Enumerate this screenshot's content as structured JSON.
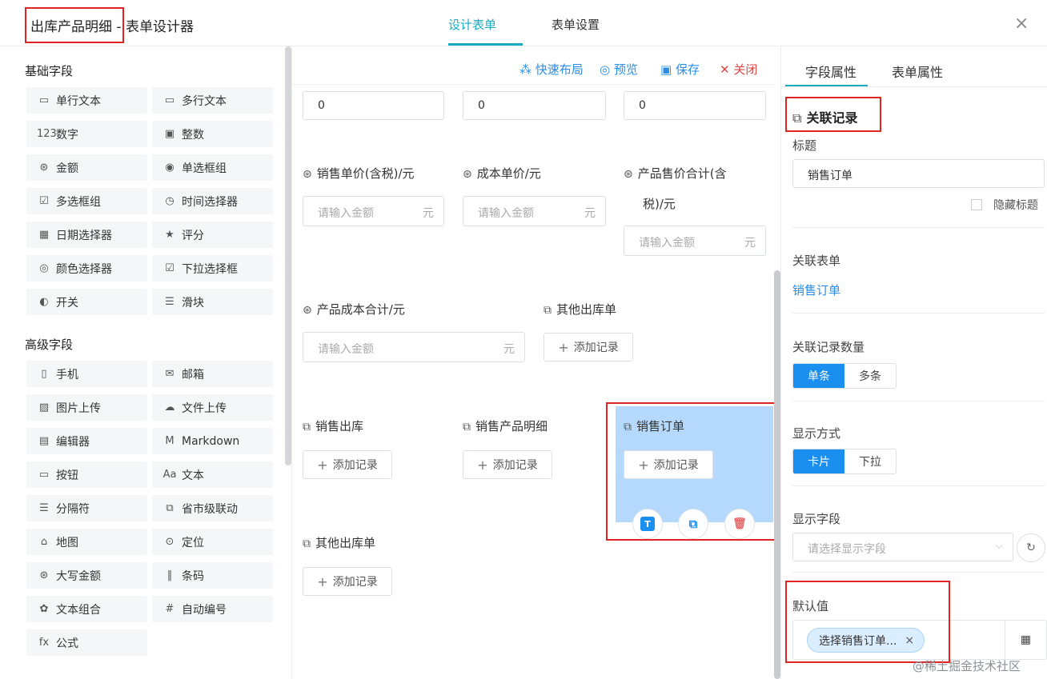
{
  "header": {
    "title_highlight": "出库产品明细",
    "title_suffix": " - 表单设计器",
    "tabs": [
      "设计表单",
      "表单设置"
    ],
    "close_icon": "×"
  },
  "palette": {
    "basic_title": "基础字段",
    "basic_items": [
      {
        "icon": "▭",
        "label": "单行文本"
      },
      {
        "icon": "▭",
        "label": "多行文本"
      },
      {
        "icon": "123",
        "label": "数字"
      },
      {
        "icon": "▣",
        "label": "整数"
      },
      {
        "icon": "⊛",
        "label": "金额"
      },
      {
        "icon": "◉",
        "label": "单选框组"
      },
      {
        "icon": "☑",
        "label": "多选框组"
      },
      {
        "icon": "◷",
        "label": "时间选择器"
      },
      {
        "icon": "▦",
        "label": "日期选择器"
      },
      {
        "icon": "★",
        "label": "评分"
      },
      {
        "icon": "◎",
        "label": "颜色选择器"
      },
      {
        "icon": "☑",
        "label": "下拉选择框"
      },
      {
        "icon": "◐",
        "label": "开关"
      },
      {
        "icon": "☰",
        "label": "滑块"
      }
    ],
    "advanced_title": "高级字段",
    "advanced_items": [
      {
        "icon": "▯",
        "label": "手机"
      },
      {
        "icon": "✉",
        "label": "邮箱"
      },
      {
        "icon": "▨",
        "label": "图片上传"
      },
      {
        "icon": "☁",
        "label": "文件上传"
      },
      {
        "icon": "▤",
        "label": "编辑器"
      },
      {
        "icon": "M",
        "label": "Markdown"
      },
      {
        "icon": "▭",
        "label": "按钮"
      },
      {
        "icon": "Aa",
        "label": "文本"
      },
      {
        "icon": "☰",
        "label": "分隔符"
      },
      {
        "icon": "⧉",
        "label": "省市级联动"
      },
      {
        "icon": "⌂",
        "label": "地图"
      },
      {
        "icon": "⊙",
        "label": "定位"
      },
      {
        "icon": "⊛",
        "label": "大写金额"
      },
      {
        "icon": "‖",
        "label": "条码"
      },
      {
        "icon": "✿",
        "label": "文本组合"
      },
      {
        "icon": "#",
        "label": "自动编号"
      },
      {
        "icon": "fx",
        "label": "公式"
      }
    ]
  },
  "toolbar": {
    "quick_layout": "快速布局",
    "preview": "预览",
    "save": "保存",
    "close": "关闭"
  },
  "canvas": {
    "number_inputs": [
      "0",
      "0",
      "0"
    ],
    "money_fields": [
      {
        "label": "销售单价(含税)/元",
        "placeholder": "请输入金额",
        "unit": "元"
      },
      {
        "label": "成本单价/元",
        "placeholder": "请输入金额",
        "unit": "元"
      },
      {
        "label": "产品售价合计(含",
        "label2": "税)/元",
        "placeholder": "请输入金额",
        "unit": "元"
      },
      {
        "label": "产品成本合计/元",
        "placeholder": "请输入金额",
        "unit": "元"
      }
    ],
    "relation_fields": [
      "其他出库单",
      "销售出库",
      "销售产品明细",
      "销售订单",
      "其他出库单"
    ],
    "add_record": "添加记录",
    "action_icons": [
      "T",
      "⧉",
      "🗑"
    ]
  },
  "props": {
    "tabs": [
      "字段属性",
      "表单属性"
    ],
    "widget_type": "关联记录",
    "title_label": "标题",
    "title_value": "销售订单",
    "hide_title": "隐藏标题",
    "rel_form_label": "关联表单",
    "rel_form_value": "销售订单",
    "count_label": "关联记录数量",
    "count_options": [
      "单条",
      "多条"
    ],
    "display_label": "显示方式",
    "display_options": [
      "卡片",
      "下拉"
    ],
    "fields_label": "显示字段",
    "fields_placeholder": "请选择显示字段",
    "default_label": "默认值",
    "default_tag": "选择销售订单...",
    "default_tag_close": "×"
  },
  "watermark": "@稀土掘金技术社区",
  "colors": {
    "accent": "#1aabc3",
    "primary": "#1a8ff0",
    "link": "#2a8ee6",
    "danger": "#e04545",
    "highlight": "#e02424",
    "selected_bg": "#b4d9fc"
  }
}
